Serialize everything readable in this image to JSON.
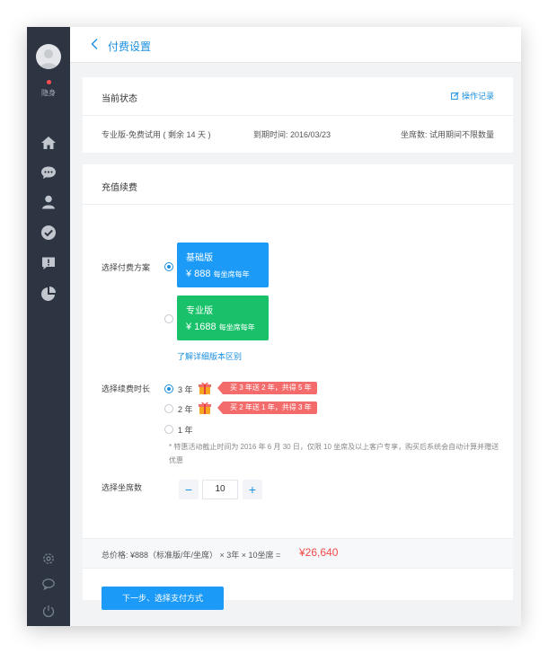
{
  "sidebar": {
    "status_label": "隐身",
    "nav_icons": [
      "home-icon",
      "chat-icon",
      "user-icon",
      "check-circle-icon",
      "feedback-icon",
      "pie-chart-icon"
    ],
    "bottom_icons": [
      "settings-icon",
      "message-icon",
      "power-icon"
    ]
  },
  "topbar": {
    "title": "付费设置"
  },
  "status_card": {
    "title": "当前状态",
    "ops_link": "操作记录",
    "edition": "专业版-免费试用 ( 剩余 14 天 )",
    "expiry": "到期时间: 2016/03/23",
    "seats": "坐席数: 试用期间不限数量"
  },
  "pay_card": {
    "title": "充值续费",
    "plan_label": "选择付费方案",
    "plans": [
      {
        "name": "基础版",
        "price": "¥ 888",
        "unit": "每坐席每年",
        "selected": true,
        "color": "#1b9af7"
      },
      {
        "name": "专业版",
        "price": "¥ 1688",
        "unit": "每坐席每年",
        "selected": false,
        "color": "#19c26a"
      }
    ],
    "detail_link": "了解详细版本区别",
    "duration_label": "选择续费时长",
    "durations": [
      {
        "label": "3 年",
        "promo": "买 3 年送 2 年，共得 5 年",
        "selected": true
      },
      {
        "label": "2 年",
        "promo": "买 2 年送 1 年，共得 3 年",
        "selected": false
      },
      {
        "label": "1 年",
        "promo": "",
        "selected": false
      }
    ],
    "note": "*  特惠活动截止时间为 2016 年 6 月 30 日，仅限 10 坐席及以上客户专享，购买后系统会自动计算并赠送优惠",
    "seats_label": "选择坐席数",
    "seats_minus": "−",
    "seats_value": "10",
    "seats_plus": "+",
    "total_text": "总价格:  ¥888（标准版/年/坐席） × 3年 × 10坐席 =",
    "total_amount": "¥26,640",
    "next_button": "下一步、选择支付方式"
  },
  "colors": {
    "accent": "#1a8fe0",
    "sidebar": "#2e3542",
    "price": "#f24a4a",
    "promo": "#f36b6b"
  }
}
